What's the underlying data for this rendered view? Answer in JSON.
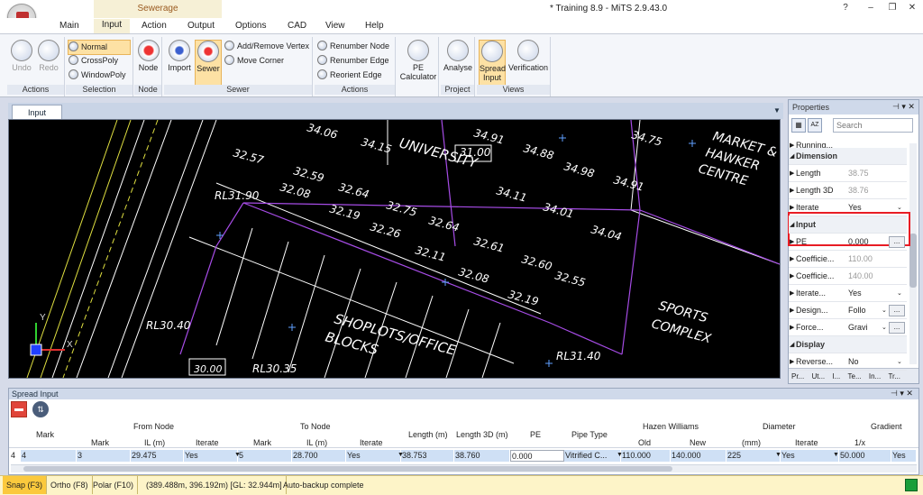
{
  "window": {
    "title": "* Training 8.9 - MiTS 2.9.43.0"
  },
  "ribbon_context": "Sewerage",
  "menu_tabs": [
    "Main",
    "Input",
    "Action",
    "Output",
    "Options",
    "CAD",
    "View",
    "Help"
  ],
  "ribbon": {
    "undo": "Undo",
    "redo": "Redo",
    "actions_label": "Actions",
    "normal": "Normal",
    "crosspoly": "CrossPoly",
    "windowpoly": "WindowPoly",
    "selection_label": "Selection",
    "node": "Node",
    "node_label": "Node",
    "import": "Import",
    "sewer": "Sewer",
    "add_remove_vertex": "Add/Remove Vertex",
    "move_corner": "Move Corner",
    "sewer_label": "Sewer",
    "renumber_node": "Renumber Node",
    "renumber_edge": "Renumber Edge",
    "reorient_edge": "Reorient Edge",
    "actions2_label": "Actions",
    "pe_calc_1": "PE",
    "pe_calc_2": "Calculator",
    "analyse": "Analyse",
    "project_label": "Project",
    "spread_1": "Spread",
    "spread_2": "Input",
    "verification": "Verification",
    "views_label": "Views"
  },
  "doc_tab": "Input",
  "cad_labels": [
    {
      "t": "34.06"
    },
    {
      "t": "34.15"
    },
    {
      "t": "31.00"
    },
    {
      "t": "34.91"
    },
    {
      "t": "34.88"
    },
    {
      "t": "34.75"
    },
    {
      "t": "32.57"
    },
    {
      "t": "32.59"
    },
    {
      "t": "32.64"
    },
    {
      "t": "32.75"
    },
    {
      "t": "34.98"
    },
    {
      "t": "34.91"
    },
    {
      "t": "RL31.90"
    },
    {
      "t": "32.08"
    },
    {
      "t": "32.19"
    },
    {
      "t": "32.26"
    },
    {
      "t": "32.64"
    },
    {
      "t": "34.11"
    },
    {
      "t": "34.01"
    },
    {
      "t": "32.11"
    },
    {
      "t": "32.61"
    },
    {
      "t": "34.04"
    },
    {
      "t": "32.08"
    },
    {
      "t": "32.60"
    },
    {
      "t": "32.55"
    },
    {
      "t": "32.19"
    },
    {
      "t": "RL30.40"
    },
    {
      "t": "RL30.35"
    },
    {
      "t": "RL31.40"
    },
    {
      "t": "30.00"
    },
    {
      "t": "UNIVERSITY"
    },
    {
      "t": "MARKET &"
    },
    {
      "t": "HAWKER"
    },
    {
      "t": "CENTRE"
    },
    {
      "t": "SHOPLOTS/OFFICE"
    },
    {
      "t": "BLOCKS"
    },
    {
      "t": "SPORTS"
    },
    {
      "t": "COMPLEX"
    },
    {
      "t": "Y"
    },
    {
      "t": "X"
    }
  ],
  "properties": {
    "title": "Properties",
    "search_placeholder": "Search",
    "rows": [
      {
        "type": "item",
        "k": "Running...",
        "v": ""
      },
      {
        "type": "cat",
        "k": "Dimension"
      },
      {
        "type": "item",
        "k": "Length",
        "v": "38.75",
        "gray": true
      },
      {
        "type": "item",
        "k": "Length 3D",
        "v": "38.76",
        "gray": true
      },
      {
        "type": "item",
        "k": "Iterate",
        "v": "Yes",
        "dd": true
      },
      {
        "type": "cat",
        "k": "Input"
      },
      {
        "type": "item",
        "k": "PE",
        "v": "0.000",
        "btn": true
      },
      {
        "type": "item",
        "k": "Coefficie...",
        "v": "110.00",
        "gray": true
      },
      {
        "type": "item",
        "k": "Coefficie...",
        "v": "140.00",
        "gray": true
      },
      {
        "type": "item",
        "k": "Iterate...",
        "v": "Yes",
        "dd": true
      },
      {
        "type": "item",
        "k": "Design...",
        "v": "Follo",
        "dd": true,
        "btn": true
      },
      {
        "type": "item",
        "k": "Force...",
        "v": "Gravi",
        "dd": true,
        "btn": true
      },
      {
        "type": "cat",
        "k": "Display"
      },
      {
        "type": "item",
        "k": "Reverse...",
        "v": "No",
        "dd": true
      }
    ],
    "tabs": [
      "Pr...",
      "Ut...",
      "I...",
      "Te...",
      "In...",
      "Tr..."
    ]
  },
  "spread": {
    "title": "Spread Input",
    "groups": {
      "from": "From Node",
      "to": "To Node",
      "hazen": "Hazen Williams",
      "diameter": "Diameter",
      "gradient": "Gradient"
    },
    "headers": {
      "mark": "Mark",
      "length": "Length (m)",
      "length3d": "Length 3D (m)",
      "pe": "PE",
      "pipe": "Pipe Type",
      "from_mark": "Mark",
      "from_il": "IL (m)",
      "from_iter": "Iterate",
      "to_mark": "Mark",
      "to_il": "IL (m)",
      "to_iter": "Iterate",
      "old": "Old",
      "new": "New",
      "mm": "(mm)",
      "d_iter": "Iterate",
      "grad": "1/x"
    },
    "row": {
      "num": "4",
      "mark": "4",
      "from_mark": "3",
      "from_il": "29.475",
      "from_iter": "Yes",
      "to_mark": "5",
      "to_il": "28.700",
      "to_iter": "Yes",
      "length": "38.753",
      "length3d": "38.760",
      "pe": "0.000",
      "pipe": "Vitrified C...",
      "old": "110.000",
      "new": "140.000",
      "mm": "225",
      "d_iter": "Yes",
      "grad": "50.000",
      "g_iter": "Yes"
    }
  },
  "status": {
    "snap": "Snap (F3)",
    "ortho": "Ortho (F8)",
    "polar": "Polar (F10)",
    "coords": "(389.488m, 396.192m) [GL: 32.944m]",
    "backup": "Auto-backup complete"
  },
  "colors": {
    "accent": "#e81c24",
    "cad_bg": "#000000",
    "purple": "#a64ce6"
  }
}
